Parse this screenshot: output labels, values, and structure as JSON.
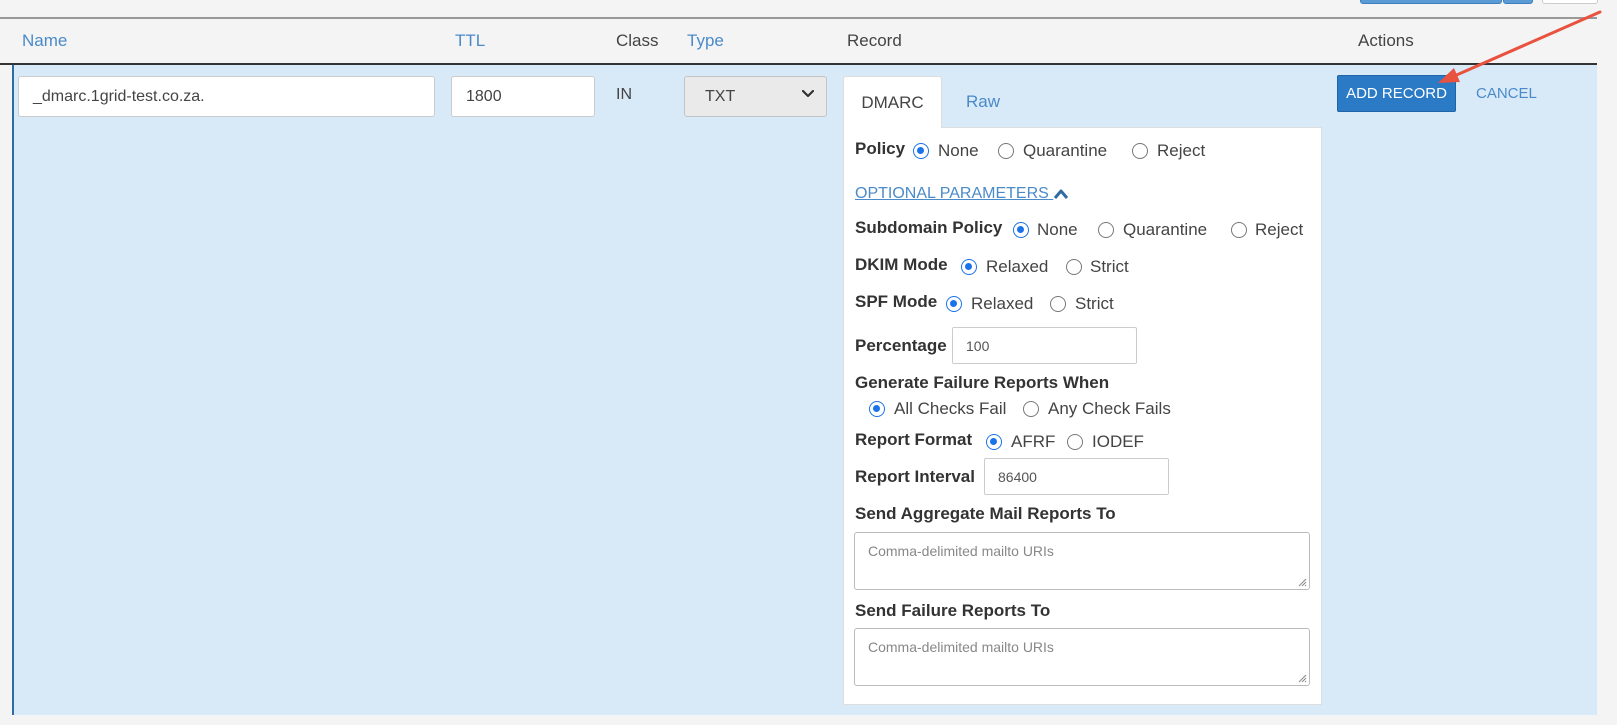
{
  "table": {
    "headers": {
      "name": "Name",
      "ttl": "TTL",
      "class": "Class",
      "type": "Type",
      "record": "Record",
      "actions": "Actions"
    }
  },
  "row": {
    "name_value": "_dmarc.1grid-test.co.za.",
    "ttl_value": "1800",
    "class_value": "IN",
    "type_value": "TXT"
  },
  "record_tabs": {
    "dmarc": "DMARC",
    "raw": "Raw",
    "active": "DMARC"
  },
  "dmarc_form": {
    "policy": {
      "label": "Policy",
      "options": [
        "None",
        "Quarantine",
        "Reject"
      ],
      "selected": "None"
    },
    "optional_parameters_link": "OPTIONAL PARAMETERS",
    "subdomain_policy": {
      "label": "Subdomain Policy",
      "options": [
        "None",
        "Quarantine",
        "Reject"
      ],
      "selected": "None"
    },
    "dkim_mode": {
      "label": "DKIM Mode",
      "options": [
        "Relaxed",
        "Strict"
      ],
      "selected": "Relaxed"
    },
    "spf_mode": {
      "label": "SPF Mode",
      "options": [
        "Relaxed",
        "Strict"
      ],
      "selected": "Relaxed"
    },
    "percentage": {
      "label": "Percentage",
      "value": "100"
    },
    "failure_reports": {
      "label": "Generate Failure Reports When",
      "options": [
        "All Checks Fail",
        "Any Check Fails"
      ],
      "selected": "All Checks Fail"
    },
    "report_format": {
      "label": "Report Format",
      "options": [
        "AFRF",
        "IODEF"
      ],
      "selected": "AFRF"
    },
    "report_interval": {
      "label": "Report Interval",
      "value": "86400"
    },
    "aggregate_reports": {
      "label": "Send Aggregate Mail Reports To",
      "placeholder": "Comma-delimited mailto URIs"
    },
    "failure_reports_to": {
      "label": "Send Failure Reports To",
      "placeholder": "Comma-delimited mailto URIs"
    }
  },
  "actions": {
    "add_record": "ADD RECORD",
    "cancel": "CANCEL"
  },
  "colors": {
    "accent": "#2a7ac6",
    "link": "#4a8ac9",
    "row_background": "#d8eaf7",
    "annotation_arrow": "#e8523f"
  },
  "icons": {
    "type_select": "chevron-down-icon",
    "optional_parameters": "chevron-up-icon",
    "textarea_resize": "resize-grip-icon"
  }
}
